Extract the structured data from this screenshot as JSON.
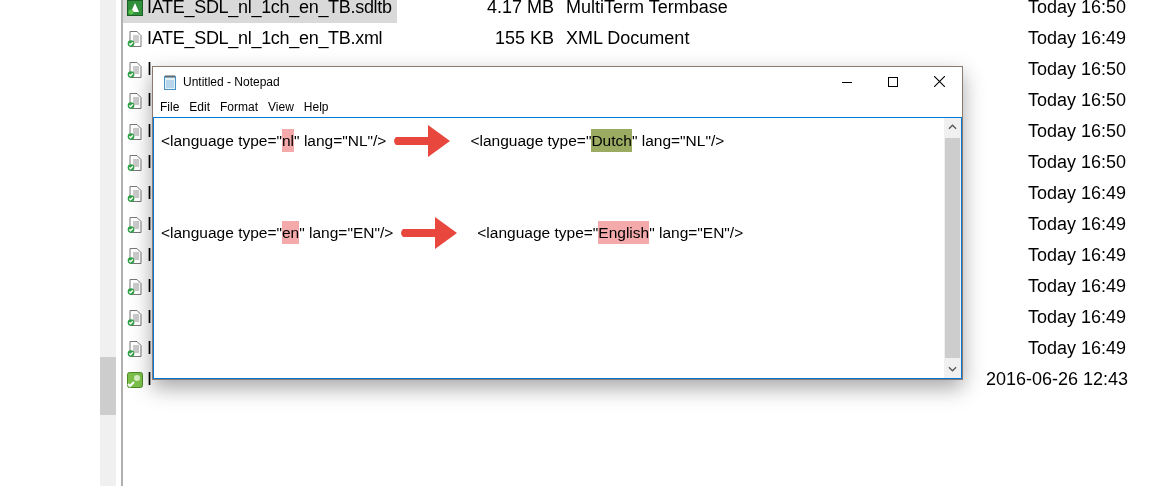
{
  "explorer": {
    "files": [
      {
        "kind": "termbase",
        "name": "IATE_SDL_nl_1ch_en_TB.sdltb",
        "size": "4.17 MB",
        "type": "MultiTerm Termbase",
        "date": "Today 16:50",
        "selected": true
      },
      {
        "kind": "document",
        "name": "IATE_SDL_nl_1ch_en_TB.xml",
        "size": "155 KB",
        "type": "XML Document",
        "date": "Today 16:49",
        "selected": false
      },
      {
        "kind": "document",
        "name": "I",
        "date": "Today 16:50",
        "selected": false
      },
      {
        "kind": "document",
        "name": "I",
        "date": "Today 16:50",
        "selected": false
      },
      {
        "kind": "document",
        "name": "I",
        "date": "Today 16:50",
        "selected": false
      },
      {
        "kind": "document",
        "name": "I",
        "date": "Today 16:50",
        "selected": false
      },
      {
        "kind": "document",
        "name": "I",
        "date": "Today 16:49",
        "selected": false
      },
      {
        "kind": "document",
        "name": "I",
        "date": "Today 16:49",
        "selected": false
      },
      {
        "kind": "document",
        "name": "I",
        "date": "Today 16:49",
        "selected": false
      },
      {
        "kind": "document",
        "name": "I",
        "date": "Today 16:49",
        "selected": false
      },
      {
        "kind": "document",
        "name": "I",
        "date": "Today 16:49",
        "selected": false
      },
      {
        "kind": "document",
        "name": "I",
        "date": "Today 16:49",
        "selected": false
      },
      {
        "kind": "memory",
        "name": "I",
        "date": "2016-06-26 12:43",
        "selected": false
      }
    ]
  },
  "notepad": {
    "title": "Untitled - Notepad",
    "menu": [
      {
        "label": "File"
      },
      {
        "label": "Edit"
      },
      {
        "label": "Format"
      },
      {
        "label": "View"
      },
      {
        "label": "Help"
      }
    ],
    "lines": [
      {
        "before": {
          "pre": "<language type=\"",
          "mark": "nl",
          "post": "\" lang=\"NL\"/>",
          "color": "#f4aaaa"
        },
        "after": {
          "pre": "<language type=\"",
          "mark": "Dutch",
          "post": "\" lang=\"NL\"/>",
          "color": "#9cab62"
        }
      },
      {
        "before": {
          "pre": "<language type=\"",
          "mark": "en",
          "post": "\" lang=\"EN\"/>",
          "color": "#f4aaaa"
        },
        "after": {
          "pre": "<language type=\"",
          "mark": "English",
          "post": "\" lang=\"EN\"/>",
          "color": "#f4aaaa"
        }
      }
    ]
  }
}
